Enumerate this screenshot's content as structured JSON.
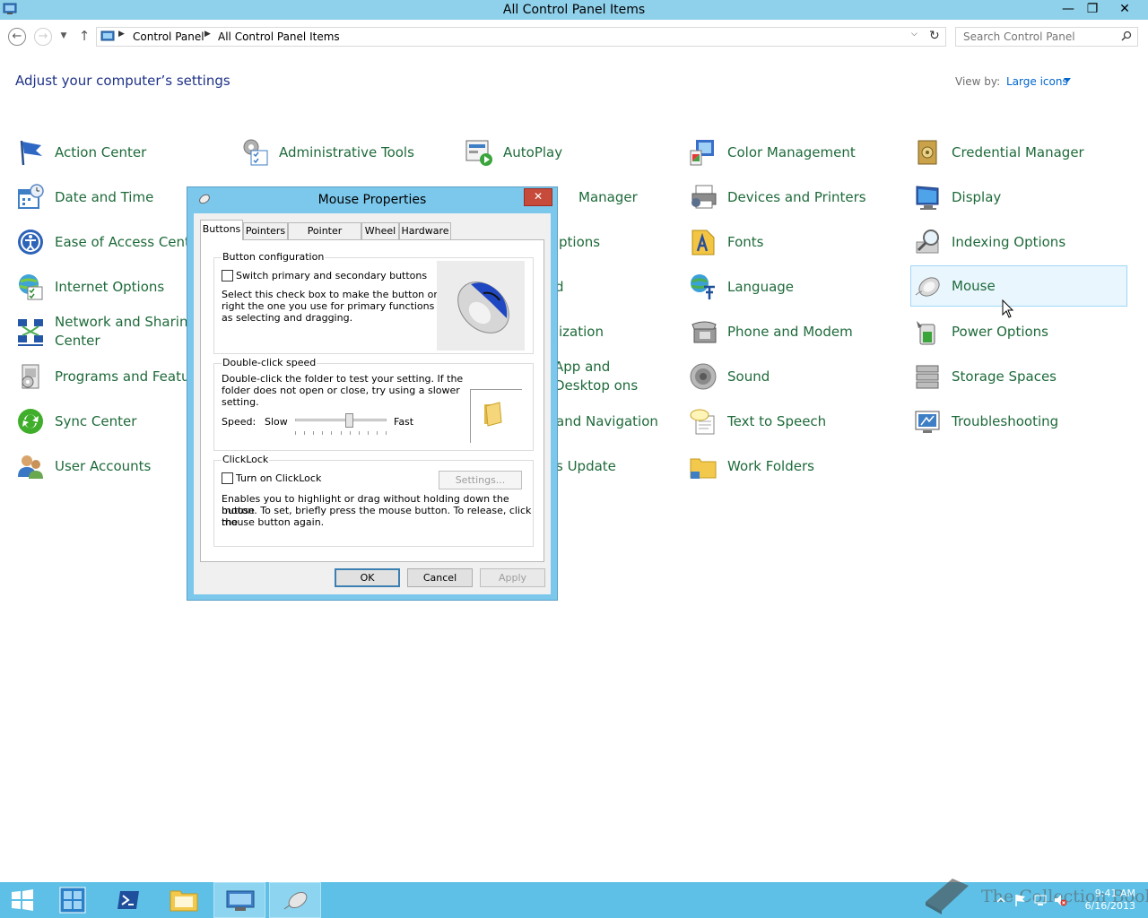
{
  "window": {
    "title": "All Control Panel Items",
    "min_glyph": "—",
    "max_glyph": "❐",
    "close_glyph": "✕"
  },
  "nav": {
    "back_glyph": "←",
    "forward_glyph": "→",
    "recent_glyph": "▼",
    "up_glyph": "↑",
    "breadcrumbs": [
      "Control Panel",
      "All Control Panel Items"
    ],
    "crumb_sep": "▶",
    "dropdown_glyph": "⌵",
    "refresh_glyph": "↻",
    "search_placeholder": "Search Control Panel"
  },
  "header": {
    "title": "Adjust your computer’s settings",
    "view_by_label": "View by:",
    "view_by_value": "Large icons"
  },
  "items": {
    "action_center": "Action Center",
    "admin_tools": "Administrative Tools",
    "autoplay": "AutoPlay",
    "color_management": "Color Management",
    "credential_manager": "Credential Manager",
    "date_time": "Date and Time",
    "device_manager_partial": "Manager",
    "devices_printers": "Devices and Printers",
    "display": "Display",
    "ease_of_access": "Ease of Access Center",
    "folder_options_partial": "ptions",
    "fonts": "Fonts",
    "indexing_options": "Indexing Options",
    "internet_options": "Internet Options",
    "keyboard_partial": "d",
    "language": "Language",
    "mouse": "Mouse",
    "network_sharing": "Network and Sharing Center",
    "personalization_partial": "ization",
    "phone_modem": "Phone and Modem",
    "power_options": "Power Options",
    "programs_features": "Programs and Features",
    "region_partial": "App and Desktop ons",
    "sound": "Sound",
    "storage_spaces": "Storage Spaces",
    "sync_center": "Sync Center",
    "taskbar_partial": "and Navigation",
    "text_to_speech": "Text to Speech",
    "troubleshooting": "Troubleshooting",
    "user_accounts": "User Accounts",
    "windows_update_partial": "s Update",
    "work_folders": "Work Folders"
  },
  "dialog": {
    "title": "Mouse Properties",
    "close_glyph": "✕",
    "tabs": [
      "Buttons",
      "Pointers",
      "Pointer Options",
      "Wheel",
      "Hardware"
    ],
    "active_tab": "Buttons",
    "button_config": {
      "label": "Button configuration",
      "checkbox_label": "Switch primary and secondary buttons",
      "checked": false,
      "desc_lines": [
        "Select this check box to make the button on the",
        "right the one you use for primary functions such",
        "as selecting and dragging."
      ]
    },
    "double_click": {
      "label": "Double-click speed",
      "desc_lines": [
        "Double-click the folder to test your setting. If the",
        "folder does not open or close, try using a slower",
        "setting."
      ],
      "speed_label": "Speed:",
      "slow_label": "Slow",
      "fast_label": "Fast",
      "speed_position": 0.6
    },
    "clicklock": {
      "label": "ClickLock",
      "checkbox_label": "Turn on ClickLock",
      "checked": false,
      "settings_button": "Settings...",
      "desc_lines": [
        "Enables you to highlight or drag without holding down the mouse",
        "button. To set, briefly press the mouse button. To release, click the",
        "mouse button again."
      ]
    },
    "ok": "OK",
    "cancel": "Cancel",
    "apply": "Apply"
  },
  "taskbar": {
    "time": "9:41 AM",
    "date": "6/16/2013",
    "watermark": "The Collection Book"
  },
  "colors": {
    "titlebar": "#8fd0ea",
    "link_green": "#1e6a3a",
    "heading_blue": "#1e3287",
    "taskbar": "#5ec0e6"
  }
}
